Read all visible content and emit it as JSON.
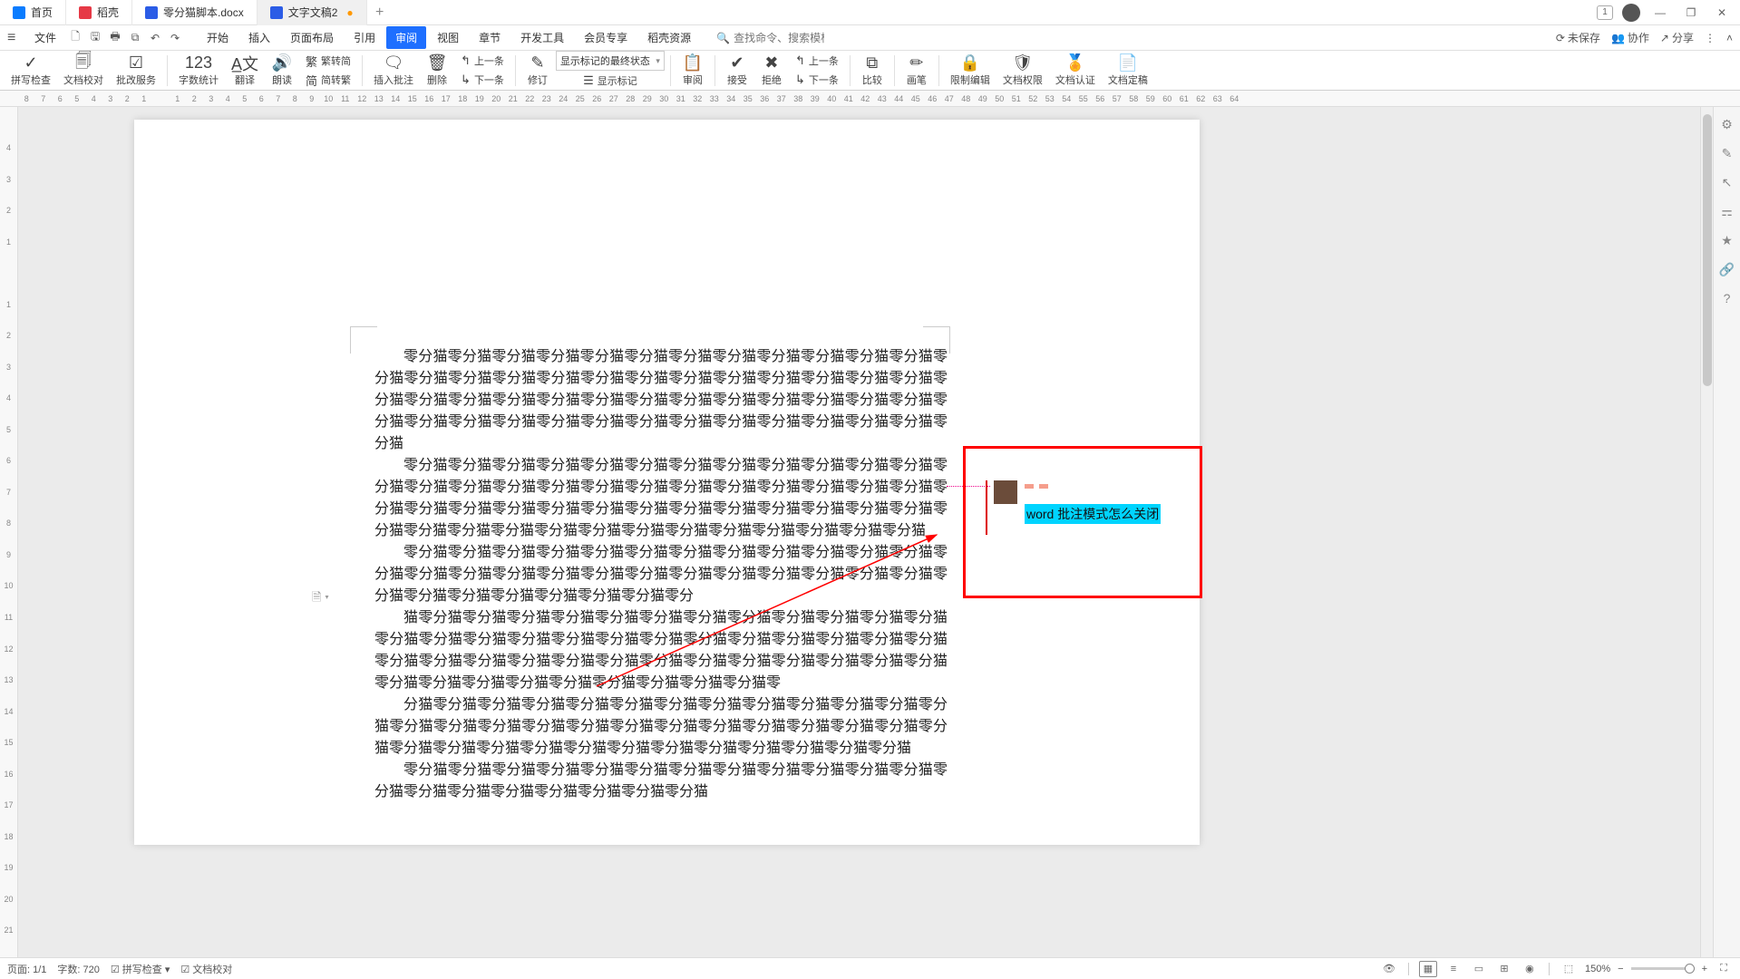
{
  "titlebar": {
    "tabs": [
      {
        "label": "首页",
        "icon": "home"
      },
      {
        "label": "稻壳",
        "icon": "doke"
      },
      {
        "label": "零分猫脚本.docx",
        "icon": "word",
        "modified": false
      },
      {
        "label": "文字文稿2",
        "icon": "word",
        "modified": true
      }
    ],
    "badge": "1"
  },
  "menubar": {
    "file": "文件",
    "items": [
      "开始",
      "插入",
      "页面布局",
      "引用",
      "审阅",
      "视图",
      "章节",
      "开发工具",
      "会员专享",
      "稻壳资源"
    ],
    "active_index": 4,
    "search_placeholder": "查找命令、搜索模板",
    "right": {
      "unsaved": "未保存",
      "coop": "协作",
      "share": "分享"
    }
  },
  "ribbon": {
    "spell_check": "拼写检查",
    "doc_proof": "文档校对",
    "revise_service": "批改服务",
    "word_count": "字数统计",
    "translate": "翻译",
    "read_aloud": "朗读",
    "simp_trad": "繁转简",
    "trad_simp": "简转繁",
    "insert_comment": "插入批注",
    "delete": "删除",
    "prev": "上一条",
    "next": "下一条",
    "revise": "修订",
    "display_select": "显示标记的最终状态",
    "show_markup": "显示标记",
    "review": "审阅",
    "accept": "接受",
    "reject": "拒绝",
    "prev2": "上一条",
    "next2": "下一条",
    "compare": "比较",
    "pen": "画笔",
    "restrict": "限制编辑",
    "doc_perm": "文档权限",
    "doc_auth": "文档认证",
    "doc_final": "文档定稿"
  },
  "document": {
    "paragraphs": [
      "零分猫零分猫零分猫零分猫零分猫零分猫零分猫零分猫零分猫零分猫零分猫零分猫零分猫零分猫零分猫零分猫零分猫零分猫零分猫零分猫零分猫零分猫零分猫零分猫零分猫零分猫零分猫零分猫零分猫零分猫零分猫零分猫零分猫零分猫零分猫零分猫零分猫零分猫零分猫零分猫零分猫零分猫零分猫零分猫零分猫零分猫零分猫零分猫零分猫零分猫零分猫零分猫",
      "零分猫零分猫零分猫零分猫零分猫零分猫零分猫零分猫零分猫零分猫零分猫零分猫零分猫零分猫零分猫零分猫零分猫零分猫零分猫零分猫零分猫零分猫零分猫零分猫零分猫零分猫零分猫零分猫零分猫零分猫零分猫零分猫零分猫零分猫零分猫零分猫零分猫零分猫零分猫零分猫零分猫零分猫零分猫零分猫零分猫零分猫零分猫零分猫零分猫零分猫零分猫",
      "零分猫零分猫零分猫零分猫零分猫零分猫零分猫零分猫零分猫零分猫零分猫零分猫零分猫零分猫零分猫零分猫零分猫零分猫零分猫零分猫零分猫零分猫零分猫零分猫零分猫零分猫零分猫零分猫零分猫零分猫零分猫零分猫零分",
      "猫零分猫零分猫零分猫零分猫零分猫零分猫零分猫零分猫零分猫零分猫零分猫零分猫零分猫零分猫零分猫零分猫零分猫零分猫零分猫零分猫零分猫零分猫零分猫零分猫零分猫零分猫零分猫零分猫零分猫零分猫零分猫零分猫零分猫零分猫零分猫零分猫零分猫零分猫零分猫零分猫零分猫零分猫零分猫零分猫零分猫零分猫零分猫零",
      "分猫零分猫零分猫零分猫零分猫零分猫零分猫零分猫零分猫零分猫零分猫零分猫零分猫零分猫零分猫零分猫零分猫零分猫零分猫零分猫零分猫零分猫零分猫零分猫零分猫零分猫零分猫零分猫零分猫零分猫零分猫零分猫零分猫零分猫零分猫零分猫零分猫零分猫",
      "零分猫零分猫零分猫零分猫零分猫零分猫零分猫零分猫零分猫零分猫零分猫零分猫零分猫零分猫零分猫零分猫零分猫零分猫零分猫零分猫"
    ]
  },
  "comment": {
    "text": "word 批注模式怎么关闭"
  },
  "statusbar": {
    "page": "页面: 1/1",
    "words": "字数: 720",
    "spell": "拼写检查",
    "proof": "文档校对",
    "zoom": "150%"
  },
  "ruler_h": [
    "8",
    "7",
    "6",
    "5",
    "4",
    "3",
    "2",
    "1",
    "",
    "1",
    "2",
    "3",
    "4",
    "5",
    "6",
    "7",
    "8",
    "9",
    "10",
    "11",
    "12",
    "13",
    "14",
    "15",
    "16",
    "17",
    "18",
    "19",
    "20",
    "21",
    "22",
    "23",
    "24",
    "25",
    "26",
    "27",
    "28",
    "29",
    "30",
    "31",
    "32",
    "33",
    "34",
    "35",
    "36",
    "37",
    "38",
    "39",
    "40",
    "41",
    "42",
    "43",
    "44",
    "45",
    "46",
    "47",
    "48",
    "49",
    "50",
    "51",
    "52",
    "53",
    "54",
    "55",
    "56",
    "57",
    "58",
    "59",
    "60",
    "61",
    "62",
    "63",
    "64"
  ],
  "ruler_v": [
    "4",
    "3",
    "2",
    "1",
    "",
    "1",
    "2",
    "3",
    "4",
    "5",
    "6",
    "7",
    "8",
    "9",
    "10",
    "11",
    "12",
    "13",
    "14",
    "15",
    "16",
    "17",
    "18",
    "19",
    "20",
    "21"
  ]
}
